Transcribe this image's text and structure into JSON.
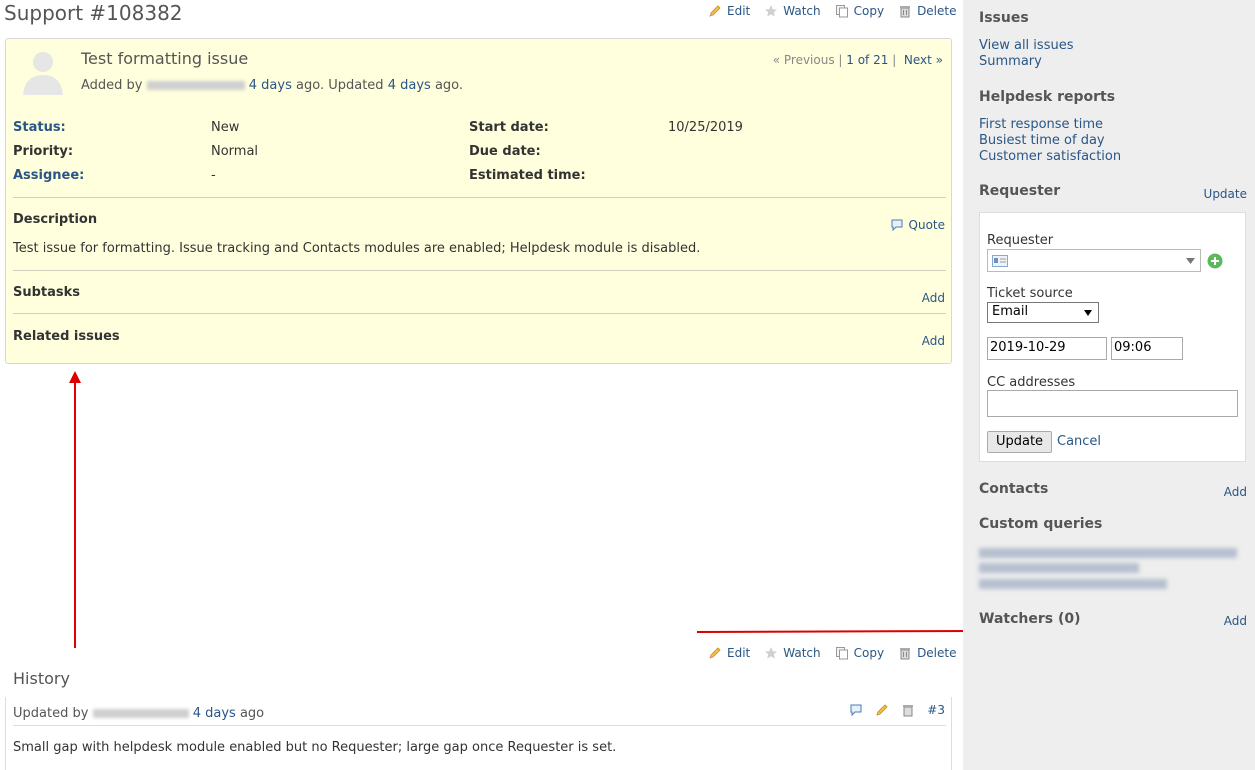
{
  "header": {
    "title": "Support #108382",
    "actions": {
      "edit": "Edit",
      "watch": "Watch",
      "copy": "Copy",
      "delete": "Delete"
    }
  },
  "issue": {
    "subject": "Test formatting issue",
    "added_by_prefix": "Added by",
    "added_ago": "4 days",
    "updated_text": "ago. Updated",
    "updated_ago": "4 days",
    "ago_suffix": "ago.",
    "nav": {
      "previous": "« Previous",
      "position": "1 of 21",
      "next": "Next »"
    },
    "attributes": {
      "status_label": "Status:",
      "status_value": "New",
      "priority_label": "Priority:",
      "priority_value": "Normal",
      "assignee_label": "Assignee:",
      "assignee_value": "-",
      "start_date_label": "Start date:",
      "start_date_value": "10/25/2019",
      "due_date_label": "Due date:",
      "due_date_value": "",
      "estimated_label": "Estimated time:",
      "estimated_value": ""
    },
    "description_title": "Description",
    "quote_label": "Quote",
    "description_text": "Test issue for formatting. Issue tracking and Contacts modules are enabled; Helpdesk module is disabled.",
    "subtasks_title": "Subtasks",
    "subtasks_add": "Add",
    "related_title": "Related issues",
    "related_add": "Add"
  },
  "history": {
    "title": "History",
    "updated_by_prefix": "Updated by",
    "updated_ago": "4 days",
    "ago_suffix": "ago",
    "journal_id": "#3",
    "notes": "Small gap with helpdesk module enabled but no Requester; large gap once Requester is set."
  },
  "sidebar": {
    "issues_title": "Issues",
    "view_all": "View all issues",
    "summary": "Summary",
    "reports_title": "Helpdesk reports",
    "report_links": [
      "First response time",
      "Busiest time of day",
      "Customer satisfaction"
    ],
    "requester_title": "Requester",
    "requester_update": "Update",
    "form": {
      "requester_label": "Requester",
      "ticket_source_label": "Ticket source",
      "ticket_source_value": "Email",
      "date_value": "2019-10-29",
      "time_value": "09:06",
      "cc_label": "CC addresses",
      "cc_value": "",
      "update_button": "Update",
      "cancel_link": "Cancel"
    },
    "contacts_title": "Contacts",
    "contacts_add": "Add",
    "custom_queries_title": "Custom queries",
    "watchers_title": "Watchers (0)",
    "watchers_add": "Add"
  },
  "colors": {
    "link": "#2a5685",
    "issue_bg": "#ffffdd",
    "sidebar_bg": "#eeeeee",
    "annotation": "#dd0000"
  },
  "icons": [
    "edit-icon",
    "star-icon",
    "copy-icon",
    "trash-icon",
    "quote-icon",
    "add-contact-icon",
    "contact-card-icon",
    "avatar-placeholder"
  ]
}
